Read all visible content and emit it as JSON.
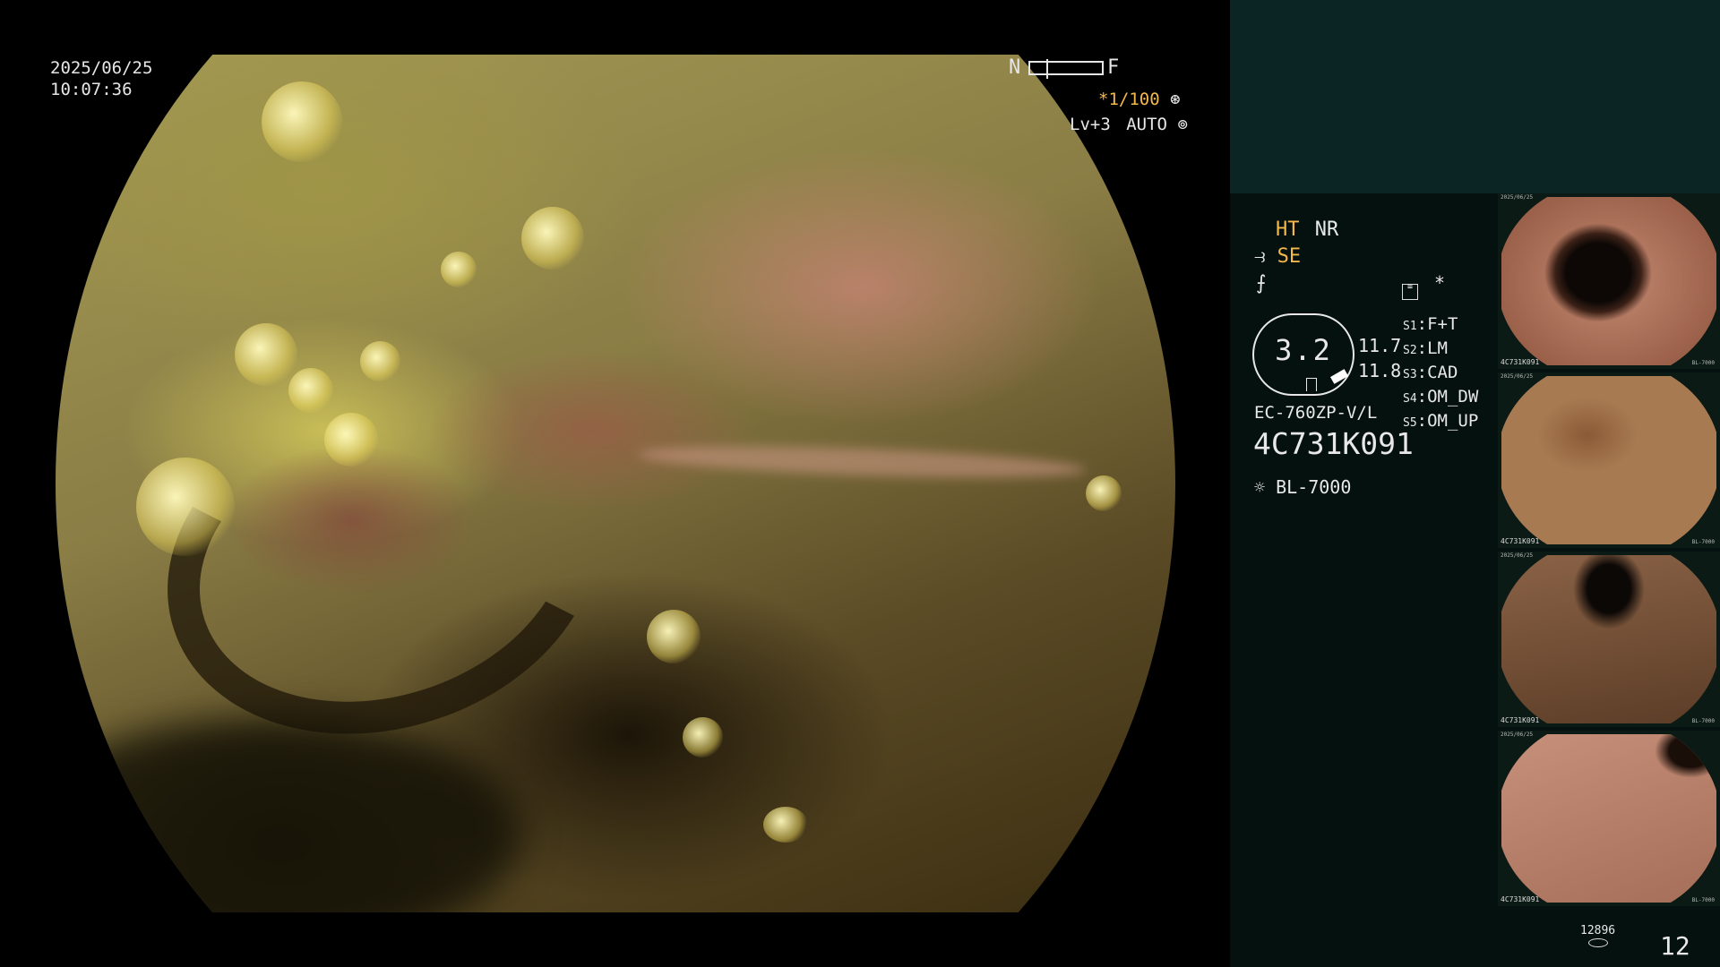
{
  "overlay": {
    "date": "2025/06/25",
    "time": "10:07:36",
    "focus_near": "N",
    "focus_far": "F",
    "shutter": "*1/100",
    "level": "Lv+3",
    "mode": "AUTO"
  },
  "panel": {
    "ht": "HT",
    "nr": "NR",
    "se": "SE",
    "zoom_value": "3.2",
    "val_a": "11.7",
    "val_b": "11.8",
    "scope_model": "EC-760ZP-V/L",
    "scope_serial": "4C731K091",
    "light_source": "BL-7000",
    "asterisk": "*",
    "switches": [
      {
        "key": "S1",
        "value": "F+T"
      },
      {
        "key": "S2",
        "value": "LM"
      },
      {
        "key": "S3",
        "value": "CAD"
      },
      {
        "key": "S4",
        "value": "OM_DW"
      },
      {
        "key": "S5",
        "value": "OM_UP"
      }
    ],
    "storage_count": "12896",
    "image_count": "12"
  },
  "thumbnails": [
    {
      "date": "2025/06/25",
      "label": "4C731K091",
      "light": "BL-7000",
      "tone": "#b07a63"
    },
    {
      "date": "2025/06/25",
      "label": "4C731K091",
      "light": "BL-7000",
      "tone": "#a06a45"
    },
    {
      "date": "2025/06/25",
      "label": "4C731K091",
      "light": "BL-7000",
      "tone": "#7a5236"
    },
    {
      "date": "2025/06/25",
      "label": "4C731K091",
      "light": "BL-7000",
      "tone": "#b88068"
    }
  ],
  "colors": {
    "accent_orange": "#f5b84a",
    "panel_bg": "#04110f",
    "panel_header": "#0a2523"
  }
}
